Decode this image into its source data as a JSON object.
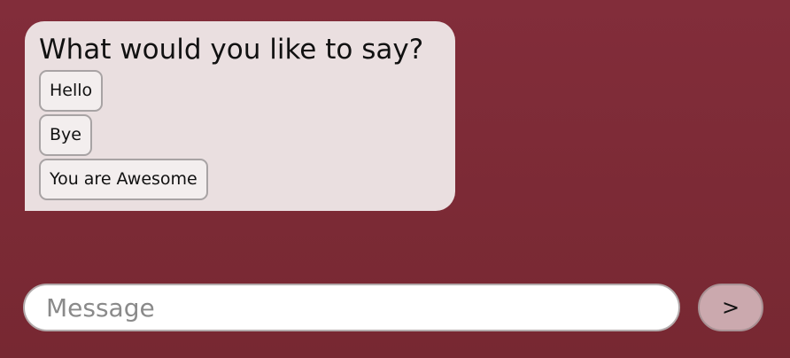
{
  "conversation": {
    "bot_message": {
      "prompt": "What would you like to say?",
      "options": [
        {
          "label": "Hello"
        },
        {
          "label": "Bye"
        },
        {
          "label": "You are Awesome"
        }
      ]
    }
  },
  "composer": {
    "placeholder": "Message",
    "value": "",
    "send_label": ">"
  },
  "colors": {
    "background": "#7d2a37",
    "bubble": "#eadfe0",
    "option_button": "#f3eeee",
    "send_button": "#cba9ae",
    "input": "#ffffff"
  }
}
